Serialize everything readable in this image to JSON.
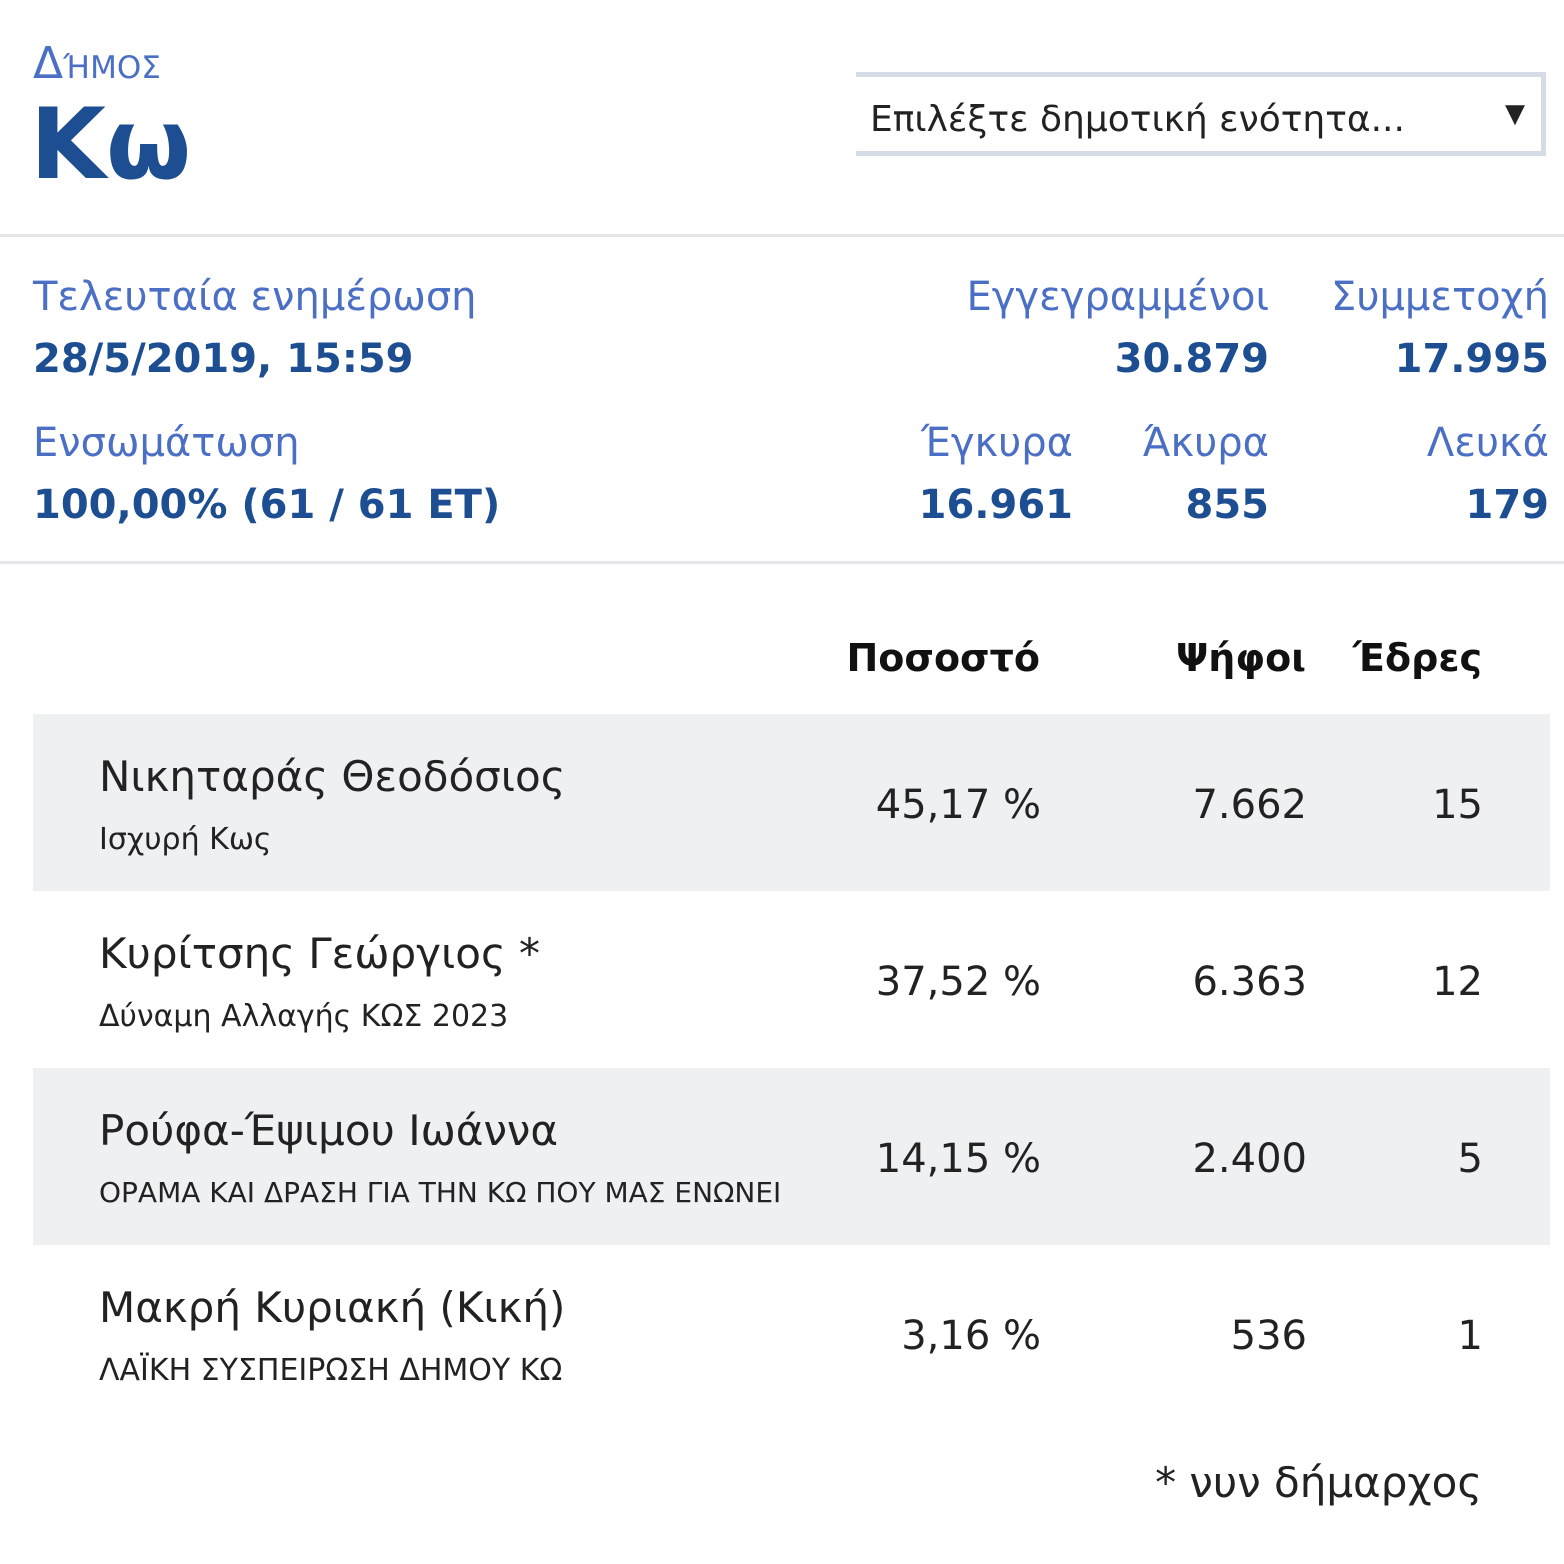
{
  "header": {
    "municipality_label": "Δήμος",
    "municipality_name": "Κω",
    "unit_select": {
      "placeholder": "Επιλέξτε δημοτική ενότητα..."
    }
  },
  "stats": {
    "last_update": {
      "label": "Τελευταία ενημέρωση",
      "value": "28/5/2019, 15:59"
    },
    "registered": {
      "label": "Εγγεγραμμένοι",
      "value": "30.879"
    },
    "turnout": {
      "label": "Συμμετοχή",
      "value": "17.995"
    },
    "integration": {
      "label": "Ενσωμάτωση",
      "value": "100,00% (61 / 61 ΕΤ)"
    },
    "valid": {
      "label": "Έγκυρα",
      "value": "16.961"
    },
    "invalid": {
      "label": "Άκυρα",
      "value": "855"
    },
    "blank": {
      "label": "Λευκά",
      "value": "179"
    }
  },
  "table": {
    "headers": {
      "percent": "Ποσοστό",
      "votes": "Ψήφοι",
      "seats": "Έδρες"
    },
    "rows": [
      {
        "name": "Νικηταράς Θεοδόσιος",
        "party": "Ισχυρή Κως",
        "percent": "45,17 %",
        "votes": "7.662",
        "seats": "15"
      },
      {
        "name": "Κυρίτσης Γεώργιος *",
        "party": "Δύναμη Αλλαγής ΚΩΣ 2023",
        "percent": "37,52 %",
        "votes": "6.363",
        "seats": "12"
      },
      {
        "name": "Ρούφα-Έψιμου Ιωάννα",
        "party": "ΟΡΑΜΑ ΚΑΙ ΔΡΑΣΗ ΓΙΑ ΤΗΝ ΚΩ ΠΟΥ ΜΑΣ ΕΝΩΝΕΙ",
        "percent": "14,15 %",
        "votes": "2.400",
        "seats": "5"
      },
      {
        "name": "Μακρή Κυριακή (Κική)",
        "party": "ΛΑΪΚΗ ΣΥΣΠΕΙΡΩΣΗ ΔΗΜΟΥ ΚΩ",
        "percent": "3,16 %",
        "votes": "536",
        "seats": "1"
      }
    ]
  },
  "footnote": "* νυν δήμαρχος",
  "icons": {
    "select_arrow": "caret-down-icon"
  }
}
